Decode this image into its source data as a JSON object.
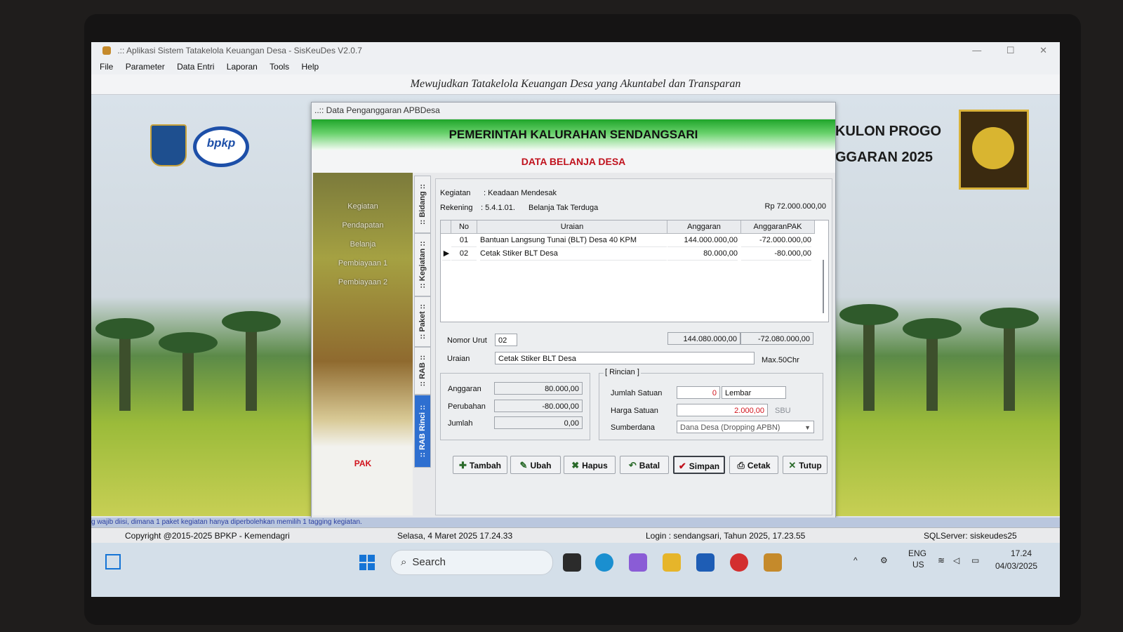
{
  "window": {
    "title": ".:: Aplikasi Sistem Tatakelola Keuangan Desa - SisKeuDes V2.0.7",
    "controls": [
      "—",
      "☐",
      "✕"
    ]
  },
  "menu": [
    "File",
    "Parameter",
    "Data Entri",
    "Laporan",
    "Tools",
    "Help"
  ],
  "motto": "Mewujudkan Tatakelola Keuangan Desa yang Akuntabel dan Transparan",
  "background_titles": {
    "line1": "KULON PROGO",
    "line2": "GGARAN 2025"
  },
  "logos": {
    "bpkp": "bpkp"
  },
  "dialog": {
    "title": "..:: Data Penganggaran APBDesa",
    "banner": "PEMERINTAH KALURAHAN SENDANGSARI",
    "subtitle": "DATA BELANJA DESA",
    "side_menu": [
      "Kegiatan",
      "Pendapatan",
      "Belanja",
      "Pembiayaan 1",
      "Pembiayaan 2"
    ],
    "pak_label": "PAK",
    "vertical_tabs": [
      ":: Bidang ::",
      ":: Kegiatan ::",
      ":: Paket ::",
      ":: RAB ::",
      ":: RAB Rinci ::"
    ],
    "active_tab": ":: RAB Rinci ::",
    "kegiatan_label": "Kegiatan",
    "kegiatan_value": ": Keadaan Mendesak",
    "rekening_label": "Rekening",
    "rekening_code": ": 5.4.1.01.",
    "rekening_name": "Belanja Tak Terduga",
    "total_amount": "Rp 72.000.000,00",
    "table": {
      "headers": [
        "No",
        "Uraian",
        "Anggaran",
        "AnggaranPAK"
      ],
      "rows": [
        {
          "no": "01",
          "uraian": "Bantuan Langsung Tunai (BLT) Desa 40 KPM",
          "anggaran": "144.000.000,00",
          "anggaran_pak": "-72.000.000,00"
        },
        {
          "no": "02",
          "uraian": "Cetak Stiker BLT Desa",
          "anggaran": "80.000,00",
          "anggaran_pak": "-80.000,00"
        }
      ],
      "selected_row_marker": "▶"
    },
    "nomor_urut_label": "Nomor Urut",
    "nomor_urut_value": "02",
    "sum_anggaran": "144.080.000,00",
    "sum_pak": "-72.080.000,00",
    "uraian_label": "Uraian",
    "uraian_value": "Cetak Stiker BLT Desa",
    "max_chr": "Max.50Chr",
    "anggaran_label": "Anggaran",
    "anggaran_value": "80.000,00",
    "perubahan_label": "Perubahan",
    "perubahan_value": "-80.000,00",
    "jumlah_label": "Jumlah",
    "jumlah_value": "0,00",
    "rincian_title": "[ Rincian ]",
    "jumlah_satuan_label": "Jumlah Satuan",
    "jumlah_satuan_value": "0",
    "satuan_value": "Lembar",
    "harga_satuan_label": "Harga Satuan",
    "harga_satuan_value": "2.000,00",
    "sbu_label": "SBU",
    "sumberdana_label": "Sumberdana",
    "sumberdana_value": "Dana Desa (Dropping APBN)",
    "buttons": [
      {
        "label": "Tambah",
        "icon": "add-icon"
      },
      {
        "label": "Ubah",
        "icon": "edit-icon"
      },
      {
        "label": "Hapus",
        "icon": "delete-icon"
      },
      {
        "label": "Batal",
        "icon": "cancel-icon"
      },
      {
        "label": "Simpan",
        "icon": "check-icon"
      },
      {
        "label": "Cetak",
        "icon": "print-icon"
      },
      {
        "label": "Tutup",
        "icon": "close-icon"
      }
    ]
  },
  "info_strip": "g wajib diisi, dimana 1 paket kegiatan hanya diperbolehkan memilih 1 tagging kegiatan.",
  "statusbar": {
    "copyright": "Copyright @2015-2025 BPKP - Kemendagri",
    "datetime": "Selasa, 4 Maret 2025  17.24.33",
    "login": "Login : sendangsari,  Tahun 2025, 17.23.55",
    "server": "SQLServer: siskeudes25"
  },
  "taskbar": {
    "search_placeholder": "Search",
    "lang_top": "ENG",
    "lang_bottom": "US",
    "clock_time": "17.24",
    "clock_date": "04/03/2025"
  },
  "colors": {
    "banner_green": "#1fa52a",
    "subtitle_red": "#c0121d",
    "active_tab_blue": "#2e6fd0",
    "negative_red": "#d1141d"
  }
}
